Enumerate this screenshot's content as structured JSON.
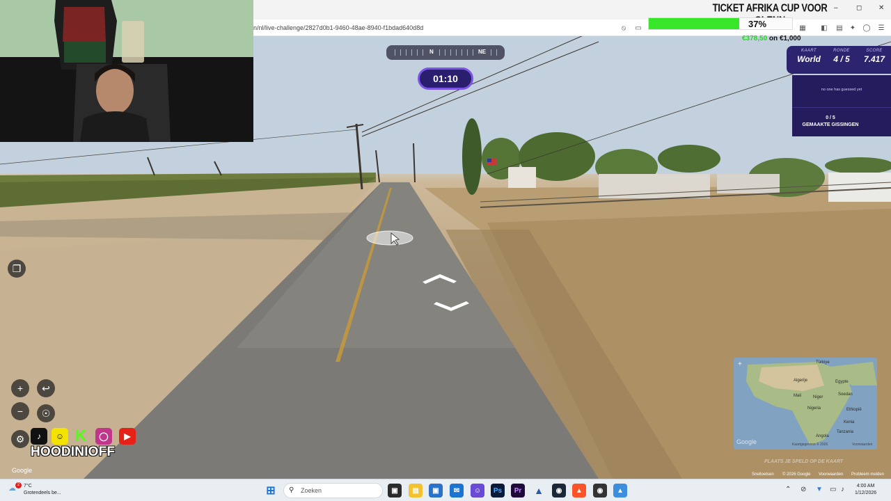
{
  "browser": {
    "url": "n/nl/live-challenge/2827d0b1-9460-48ae-8940-f1bdad640d8d"
  },
  "stream": {
    "ticket_title": "TICKET AFRIKA CUP VOOR GLENN",
    "progress_percent": 37,
    "progress_label": "37%",
    "money_raised": "€378,50",
    "money_separator": " on ",
    "money_goal": "€1,000",
    "handle": "HOODINIOFF"
  },
  "game": {
    "compass": {
      "n": "N",
      "ne": "NE"
    },
    "timer": "01:10",
    "panel": {
      "map_caption": "KAART",
      "map_value": "World",
      "round_caption": "RONDE",
      "round_value": "4 / 5",
      "score_caption": "SCORE",
      "score_value": "7.417"
    },
    "no_guess": "no one has guessed yet",
    "guess_count": "0 / 5",
    "guess_label": "GEMAAKTE GISSINGEN",
    "place_hint": "PLAATS JE SPELD OP DE KAART"
  },
  "map": {
    "labels": [
      "Türkiye",
      "Algerije",
      "Egypte",
      "Mali",
      "Niger",
      "Nigeria",
      "Soedan",
      "Ethiopië",
      "Kenia",
      "Tanzania",
      "Angola"
    ],
    "watermark": "Google",
    "footer_left": "Kaartgegevens © 2026",
    "footer_right": "Voorwaarden"
  },
  "streetview": {
    "google": "Google",
    "footer": [
      "Sneltoetsen",
      "© 2026 Google",
      "Voorwaarden",
      "Probleem melden"
    ]
  },
  "taskbar": {
    "weather_temp": "7°C",
    "weather_desc": "Grotendeels be...",
    "notification_count": "2",
    "search_placeholder": "Zoeken",
    "time": "4:00 AM",
    "date": "1/12/2026"
  },
  "colors": {
    "panel": "#2c246f",
    "timer_border": "#7c55e6",
    "progress": "#38e62a"
  }
}
